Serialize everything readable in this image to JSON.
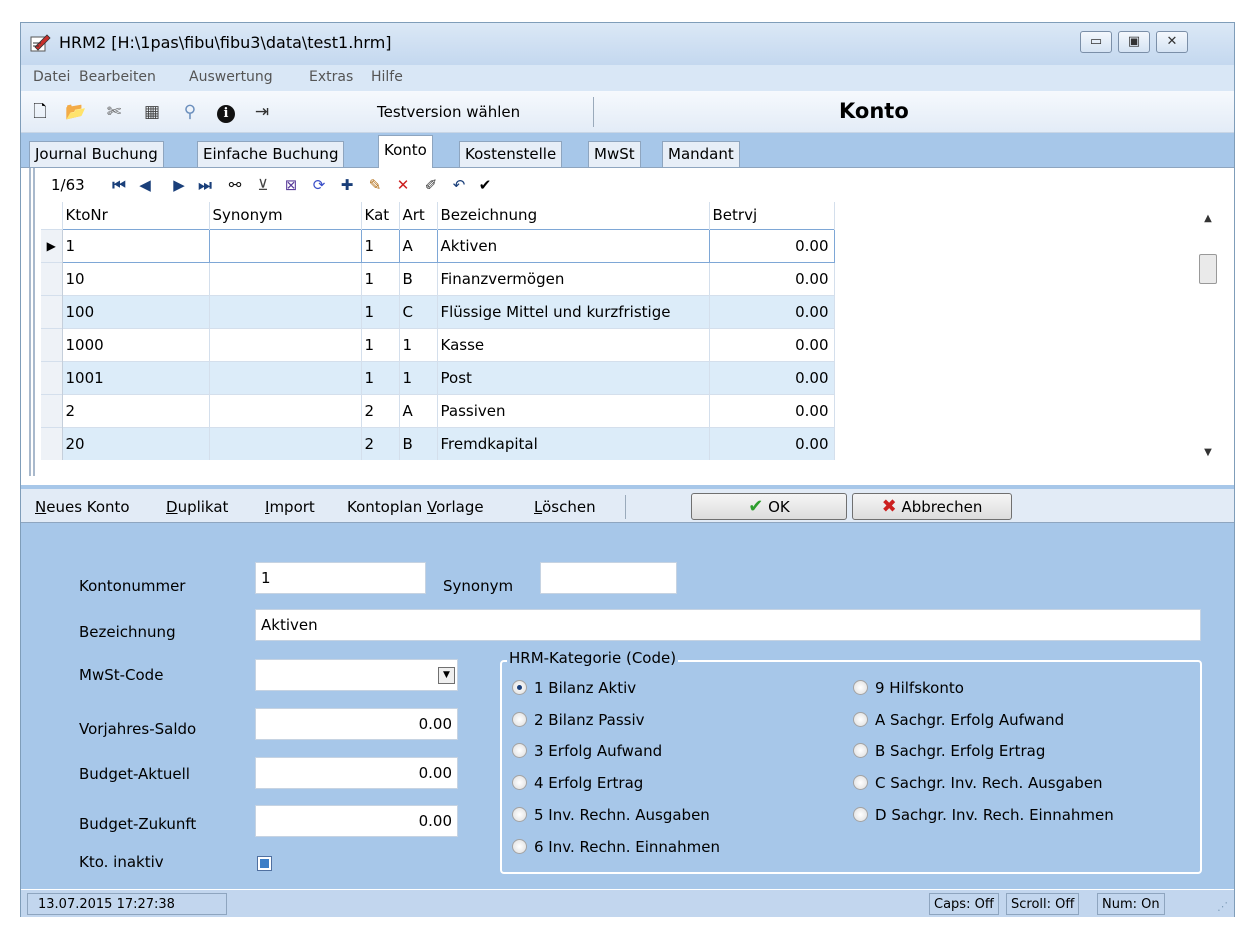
{
  "window": {
    "title": "HRM2  [H:\\1pas\\fibu\\fibu3\\data\\test1.hrm]",
    "controls": {
      "minimize": "▭",
      "maximize": "▣",
      "close": "✕"
    }
  },
  "menu": [
    "Datei",
    "Bearbeiten",
    "Auswertung",
    "Extras",
    "Hilfe"
  ],
  "toolbar": {
    "icons": [
      "new-file-icon",
      "open-folder-icon",
      "delete-tool-icon",
      "calculator-icon",
      "search-icon",
      "info-icon",
      "exit-icon"
    ],
    "testversion_label": "Testversion wählen",
    "heading": "Konto"
  },
  "tabs": [
    {
      "label": "Journal Buchung",
      "active": false
    },
    {
      "label": "Einfache Buchung",
      "active": false
    },
    {
      "label": "Konto",
      "active": true
    },
    {
      "label": "Kostenstelle",
      "active": false
    },
    {
      "label": "MwSt",
      "active": false
    },
    {
      "label": "Mandant",
      "active": false
    }
  ],
  "navigator": {
    "record_count": "1/63"
  },
  "grid": {
    "columns": [
      "KtoNr",
      "Synonym",
      "Kat",
      "Art",
      "Bezeichnung",
      "Betrvj"
    ],
    "rows": [
      {
        "ktonr": "1",
        "synonym": "",
        "kat": "1",
        "art": "A",
        "bezeichnung": "Aktiven",
        "betrvj": "0.00",
        "selected": true
      },
      {
        "ktonr": "10",
        "synonym": "",
        "kat": "1",
        "art": "B",
        "bezeichnung": "Finanzvermögen",
        "betrvj": "0.00"
      },
      {
        "ktonr": "100",
        "synonym": "",
        "kat": "1",
        "art": "C",
        "bezeichnung": "Flüssige Mittel und kurzfristige",
        "betrvj": "0.00"
      },
      {
        "ktonr": "1000",
        "synonym": "",
        "kat": "1",
        "art": "1",
        "bezeichnung": "Kasse",
        "betrvj": "0.00"
      },
      {
        "ktonr": "1001",
        "synonym": "",
        "kat": "1",
        "art": "1",
        "bezeichnung": "Post",
        "betrvj": "0.00"
      },
      {
        "ktonr": "2",
        "synonym": "",
        "kat": "2",
        "art": "A",
        "bezeichnung": "Passiven",
        "betrvj": "0.00"
      },
      {
        "ktonr": "20",
        "synonym": "",
        "kat": "2",
        "art": "B",
        "bezeichnung": "Fremdkapital",
        "betrvj": "0.00"
      }
    ]
  },
  "actions": {
    "neues_konto": {
      "key": "N",
      "rest": "eues Konto"
    },
    "duplikat": {
      "key": "D",
      "rest": "uplikat"
    },
    "import": {
      "key": "I",
      "rest": "mport"
    },
    "kontoplan_vorlage": {
      "pre": "Kontoplan ",
      "key": "V",
      "rest": "orlage"
    },
    "loeschen": {
      "key": "L",
      "rest": "öschen"
    },
    "ok": "OK",
    "abbrechen": "Abbrechen"
  },
  "form": {
    "labels": {
      "kontonummer": "Kontonummer",
      "synonym": "Synonym",
      "bezeichnung": "Bezeichnung",
      "mwst_code": "MwSt-Code",
      "vorjahres_saldo": "Vorjahres-Saldo",
      "budget_aktuell": "Budget-Aktuell",
      "budget_zukunft": "Budget-Zukunft",
      "kto_inaktiv": "Kto. inaktiv"
    },
    "values": {
      "kontonummer": "1",
      "synonym": "",
      "bezeichnung": "Aktiven",
      "mwst_code": "",
      "vorjahres_saldo": "0.00",
      "budget_aktuell": "0.00",
      "budget_zukunft": "0.00",
      "kto_inaktiv": true
    },
    "hrm_kategorie": {
      "legend": "HRM-Kategorie (Code)",
      "selected": "1",
      "options": [
        {
          "code": "1",
          "label": "1  Bilanz Aktiv"
        },
        {
          "code": "2",
          "label": "2  Bilanz Passiv"
        },
        {
          "code": "3",
          "label": "3  Erfolg Aufwand"
        },
        {
          "code": "4",
          "label": "4  Erfolg Ertrag"
        },
        {
          "code": "5",
          "label": "5  Inv. Rechn. Ausgaben"
        },
        {
          "code": "6",
          "label": "6  Inv. Rechn. Einnahmen"
        },
        {
          "code": "9",
          "label": "9  Hilfskonto"
        },
        {
          "code": "A",
          "label": "A  Sachgr. Erfolg Aufwand"
        },
        {
          "code": "B",
          "label": "B  Sachgr. Erfolg Ertrag"
        },
        {
          "code": "C",
          "label": "C  Sachgr. Inv. Rech. Ausgaben"
        },
        {
          "code": "D",
          "label": "D  Sachgr. Inv. Rech. Einnahmen"
        }
      ]
    }
  },
  "status": {
    "datetime": "13.07.2015  17:27:38",
    "caps": "Caps: Off",
    "scroll": "Scroll: Off",
    "num": "Num: On"
  },
  "colors": {
    "form_bg": "#a7c7e9",
    "row_alt": "#dcecf9",
    "ok_check": "#2e9e2e",
    "cancel_x": "#cc1f1f"
  }
}
